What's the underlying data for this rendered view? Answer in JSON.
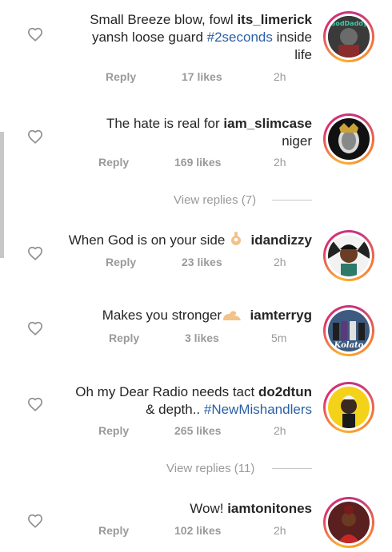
{
  "colors": {
    "text": "#262626",
    "meta": "#9a9a9a",
    "hashtag": "#2a5fa6",
    "story_ring": "#e1306c"
  },
  "comments": [
    {
      "username": "its_limerick",
      "line1_pre": "Small Breeze blow, fowl ",
      "line2_pre": "yansh loose guard ",
      "hashtag": "#2seconds",
      "line2_post": " inside",
      "line3": "life",
      "reply": "Reply",
      "likes": "17 likes",
      "time": "2h",
      "avatar_label": "GodDaddy"
    },
    {
      "username": "iam_slimcase",
      "text_pre": "The hate is real for ",
      "line2": "niger",
      "reply": "Reply",
      "likes": "169 likes",
      "time": "2h"
    },
    {
      "username": "idandizzy",
      "text_pre": "When God is on your side ",
      "emoji": "ok-hand-emoji",
      "reply": "Reply",
      "likes": "23 likes",
      "time": "2h"
    },
    {
      "username": "iamterryg",
      "text_pre": "Makes you stronger",
      "emoji": "flexed-biceps-emoji",
      "reply": "Reply",
      "likes": "3 likes",
      "time": "5m",
      "avatar_label": "Kolato"
    },
    {
      "username": "do2dtun",
      "text_pre": "Oh my Dear Radio needs tact ",
      "line2_pre": "& depth.. ",
      "hashtag": "#NewMishandlers",
      "reply": "Reply",
      "likes": "265 likes",
      "time": "2h"
    },
    {
      "username": "iamtonitones",
      "text_pre": "Wow! ",
      "reply": "Reply",
      "likes": "102 likes",
      "time": "2h"
    }
  ],
  "view_replies": [
    "View replies (7)",
    "View replies (11)"
  ]
}
